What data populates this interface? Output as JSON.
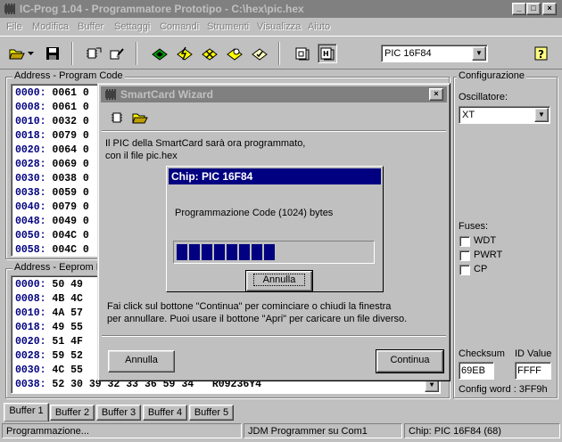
{
  "window": {
    "title": "IC-Prog 1.04 - Programmatore Prototipo - C:\\hex\\pic.hex",
    "minimize": "_",
    "maximize": "□",
    "close": "×"
  },
  "menu": [
    "File",
    "Modifica",
    "Buffer",
    "Settaggi",
    "Comandi",
    "Strumenti",
    "Visualizza",
    "Aiuto"
  ],
  "toolbar": {
    "device_select": "PIC 16F84",
    "help_glyph": "?"
  },
  "program_code": {
    "label": "Address - Program Code",
    "rows": [
      {
        "addr": "0000:",
        "data": "0061 0"
      },
      {
        "addr": "0008:",
        "data": "0061 0"
      },
      {
        "addr": "0010:",
        "data": "0032 0"
      },
      {
        "addr": "0018:",
        "data": "0079 0"
      },
      {
        "addr": "0020:",
        "data": "0064 0"
      },
      {
        "addr": "0028:",
        "data": "0069 0"
      },
      {
        "addr": "0030:",
        "data": "0038 0"
      },
      {
        "addr": "0038:",
        "data": "0059 0"
      },
      {
        "addr": "0040:",
        "data": "0079 0"
      },
      {
        "addr": "0048:",
        "data": "0049 0"
      },
      {
        "addr": "0050:",
        "data": "004C 0"
      },
      {
        "addr": "0058:",
        "data": "004C 0"
      }
    ]
  },
  "eeprom": {
    "label": "Address - Eeprom D",
    "rows": [
      {
        "addr": "0000:",
        "data": "50 49"
      },
      {
        "addr": "0008:",
        "data": "4B 4C"
      },
      {
        "addr": "0010:",
        "data": "4A 57"
      },
      {
        "addr": "0018:",
        "data": "49 55"
      },
      {
        "addr": "0020:",
        "data": "51 4F"
      },
      {
        "addr": "0028:",
        "data": "59 52"
      },
      {
        "addr": "0030:",
        "data": "4C 55"
      },
      {
        "addr": "0038:",
        "data": "52 30 39 32 33 36 59 34   R09236Y4"
      }
    ]
  },
  "config": {
    "label": "Configurazione",
    "oscillator_label": "Oscillatore:",
    "oscillator_value": "XT",
    "fuses_label": "Fuses:",
    "fuses": [
      {
        "name": "WDT",
        "checked": false
      },
      {
        "name": "PWRT",
        "checked": false
      },
      {
        "name": "CP",
        "checked": false
      }
    ],
    "checksum_label": "Checksum",
    "checksum_value": "69EB",
    "id_label": "ID Value",
    "id_value": "FFFF",
    "config_word": "Config word : 3FF9h"
  },
  "tabs": [
    "Buffer 1",
    "Buffer 2",
    "Buffer 3",
    "Buffer 4",
    "Buffer 5"
  ],
  "status": {
    "left": "Programmazione...",
    "middle": "JDM Programmer su Com1",
    "right": "Chip: PIC 16F84  (68)"
  },
  "wizard": {
    "title": "SmartCard Wizard",
    "message_line1": "Il PIC della SmartCard sarà ora programmato,",
    "message_line2": "con il file pic.hex",
    "instruction_line1": "Fai click sul bottone \"Continua\" per cominciare o chiudi la finestra",
    "instruction_line2": "per annullare. Puoi usare il bottone \"Apri\" per caricare un file diverso.",
    "cancel_label": "Annulla",
    "continue_label": "Continua",
    "close": "×"
  },
  "chip_dialog": {
    "title": "Chip: PIC 16F84",
    "message": "Programmazione Code (1024) bytes",
    "progress_blocks": 8,
    "progress_fraction": 0.48,
    "cancel_label": "Annulla"
  }
}
